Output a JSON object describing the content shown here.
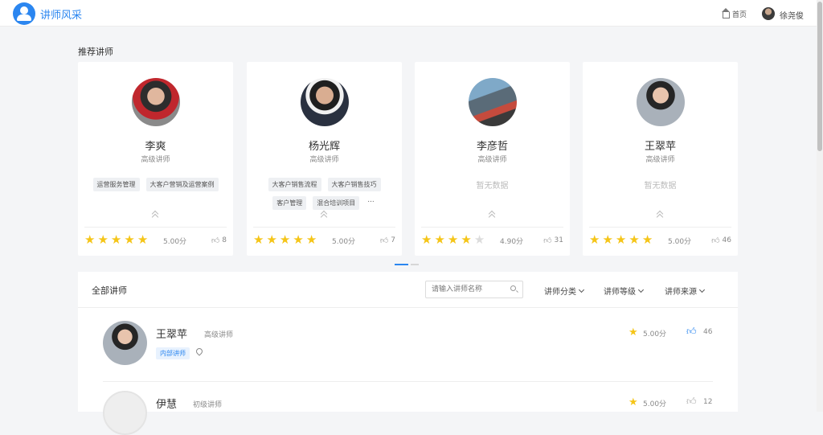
{
  "header": {
    "logo_text": "讲师风采",
    "home_label": "首页",
    "user_name": "徐尧俊"
  },
  "recommended": {
    "title": "推荐讲师",
    "cards": [
      {
        "name": "李爽",
        "level": "高级讲师",
        "tags": [
          "运营服务管理",
          "大客户营销及运营案例"
        ],
        "more": "",
        "empty": "",
        "rating": 5,
        "score": "5.00分",
        "likes": "8"
      },
      {
        "name": "杨光辉",
        "level": "高级讲师",
        "tags": [
          "大客户销售流程",
          "大客户销售技巧",
          "客户管理",
          "混合培训项目"
        ],
        "more": "...",
        "empty": "",
        "rating": 5,
        "score": "5.00分",
        "likes": "7"
      },
      {
        "name": "李彦哲",
        "level": "高级讲师",
        "tags": [],
        "more": "",
        "empty": "暂无数据",
        "rating": 4,
        "score": "4.90分",
        "likes": "31"
      },
      {
        "name": "王翠苹",
        "level": "高级讲师",
        "tags": [],
        "more": "",
        "empty": "暂无数据",
        "rating": 5,
        "score": "5.00分",
        "likes": "46"
      }
    ]
  },
  "all": {
    "title": "全部讲师",
    "search_placeholder": "请输入讲师名称",
    "filters": [
      "讲师分类",
      "讲师等级",
      "讲师来源"
    ],
    "rows": [
      {
        "name": "王翠苹",
        "level": "高级讲师",
        "badge": "内部讲师",
        "score": "5.00分",
        "likes": "46",
        "liked": true
      },
      {
        "name": "伊慧",
        "level": "初级讲师",
        "badge": "",
        "score": "5.00分",
        "likes": "12",
        "liked": false
      }
    ]
  },
  "colors": {
    "accent": "#2b86f0",
    "star": "#f5c518"
  }
}
